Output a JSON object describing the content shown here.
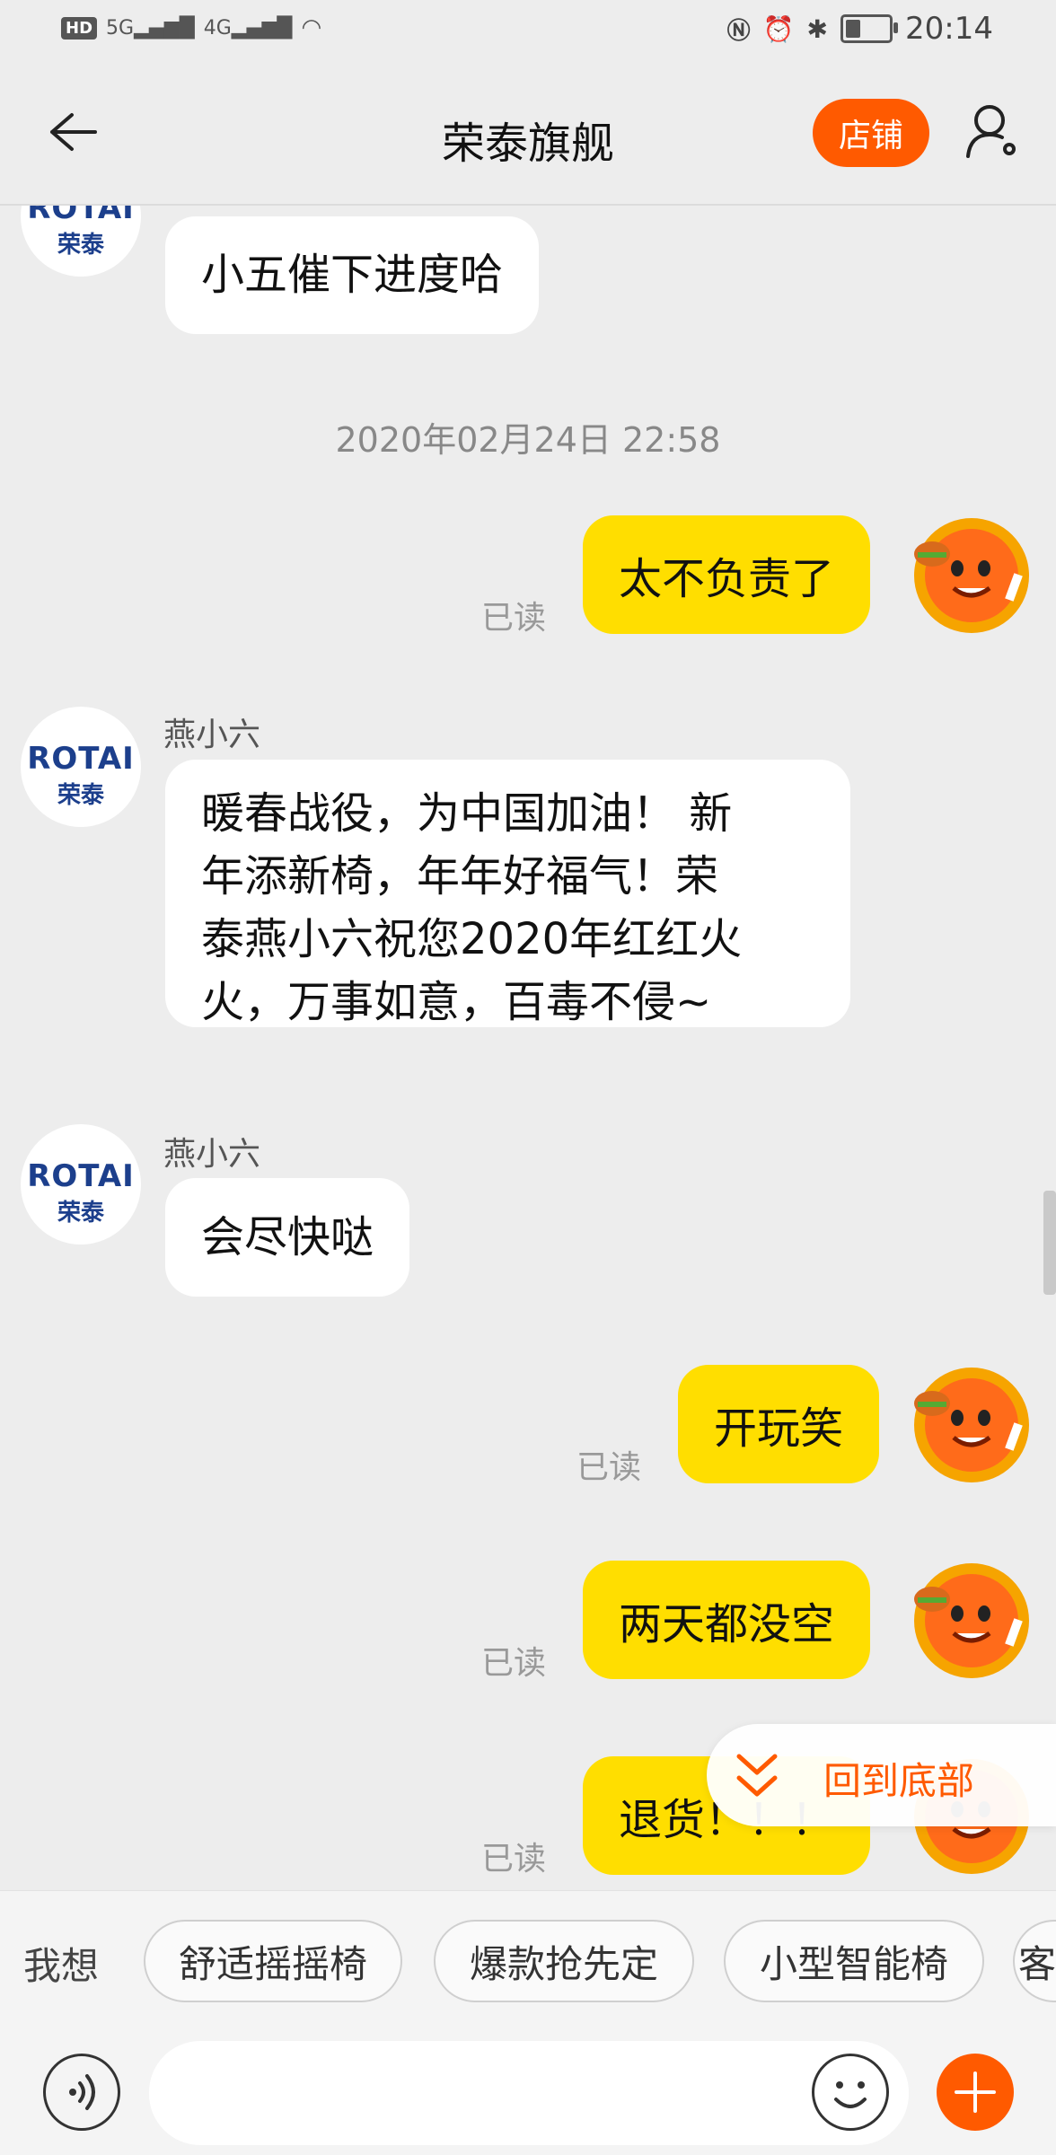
{
  "status_bar": {
    "time": "20:14",
    "hd": "HD",
    "sig1": "5G",
    "sig2": "4G",
    "battery_level": 0.35
  },
  "header": {
    "title": "荣泰旗舰",
    "store_label": "店铺"
  },
  "shop_avatar": {
    "brand": "ROTAI",
    "cn": "荣泰"
  },
  "messages": {
    "m1": {
      "text": "小五催下进度哈"
    },
    "timestamp": "2020年02月24日 22:58",
    "m2": {
      "text": "太不负责了",
      "read": "已读"
    },
    "m3": {
      "sender": "燕小六",
      "lines": [
        "暖春战役，为中国加油！ 新",
        "年添新椅，年年好福气！荣",
        "泰燕小六祝您2020年红红火",
        "火，万事如意，百毒不侵~"
      ]
    },
    "m4": {
      "sender": "燕小六",
      "text": "会尽快哒"
    },
    "m5": {
      "text": "开玩笑",
      "read": "已读"
    },
    "m6": {
      "text": "两天都没空",
      "read": "已读"
    },
    "m7": {
      "text": "退货！！！",
      "read": "已读"
    }
  },
  "back_to_bottom": "回到底部",
  "suggestions": {
    "prefix": "我想",
    "chips": [
      "舒适摇摇椅",
      "爆款抢先定",
      "小型智能椅",
      "客"
    ]
  },
  "input": {
    "placeholder": ""
  },
  "colors": {
    "accent": "#ff5a00",
    "my_bubble": "#ffde00",
    "shop_blue": "#1c3f8c"
  }
}
